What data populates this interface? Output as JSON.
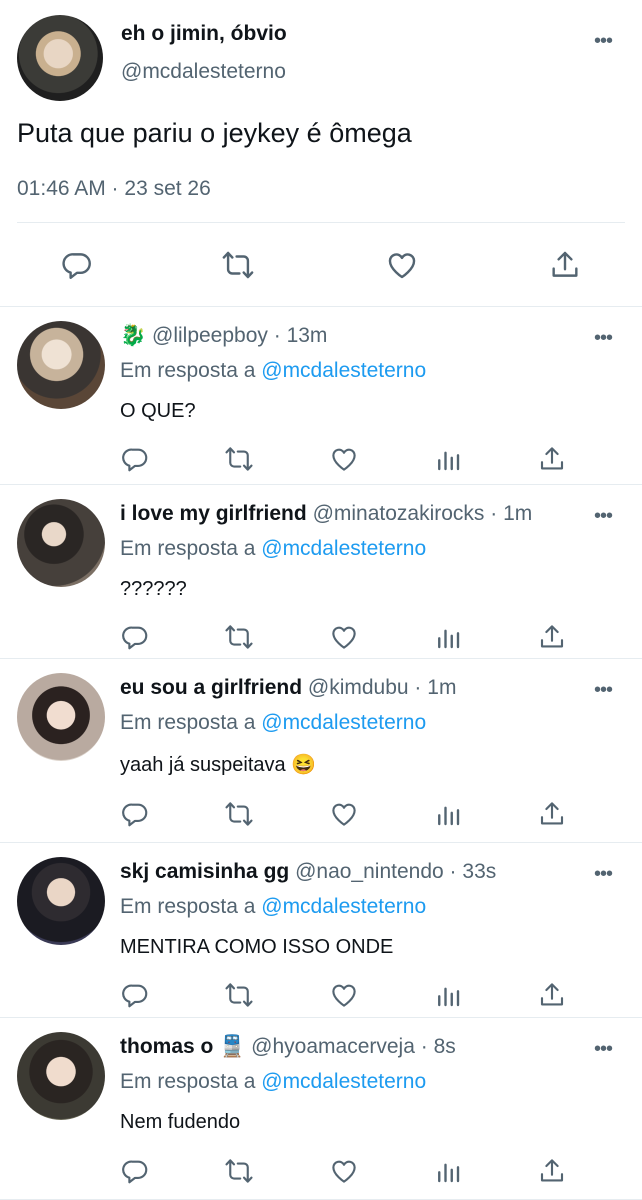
{
  "main_tweet": {
    "name": "eh o jimin, óbvio",
    "handle": "@mcdalesteterno",
    "text": "Puta que pariu o jeykey é ômega",
    "meta": "01:46 AM · 23 set 26",
    "more_label": "•••",
    "actions": [
      "reply-icon",
      "retweet-icon",
      "like-icon",
      "share-icon"
    ]
  },
  "reply_label": "Em resposta a",
  "reply_mention": "@mcdalesteterno",
  "replies": [
    {
      "emoji_prefix": "🐉",
      "name": "",
      "handle": "@lilpeepboy",
      "dot": "·",
      "time": "13m",
      "text": "O QUE?",
      "more_label": "•••"
    },
    {
      "emoji_prefix": "",
      "name": "i love my girlfriend",
      "handle": "@minatozakirocks",
      "dot": "·",
      "time": "1m",
      "text": "??????",
      "more_label": "•••"
    },
    {
      "emoji_prefix": "",
      "name": "eu sou a girlfriend",
      "handle": "@kimdubu",
      "dot": "·",
      "time": "1m",
      "text": "yaah já suspeitava 😆",
      "more_label": "•••"
    },
    {
      "emoji_prefix": "",
      "name": "skj camisinha gg",
      "handle": "@nao_nintendo",
      "dot": "·",
      "time": "33s",
      "text": "MENTIRA COMO ISSO ONDE",
      "more_label": "•••"
    },
    {
      "emoji_prefix": "",
      "name": "thomas o 🚆",
      "handle": "@hyoamacerveja",
      "dot": "·",
      "time": "8s",
      "text": "Nem fudendo",
      "more_label": "•••"
    }
  ],
  "reply_actions": [
    "reply-icon",
    "retweet-icon",
    "like-icon",
    "analytics-icon",
    "share-icon"
  ]
}
